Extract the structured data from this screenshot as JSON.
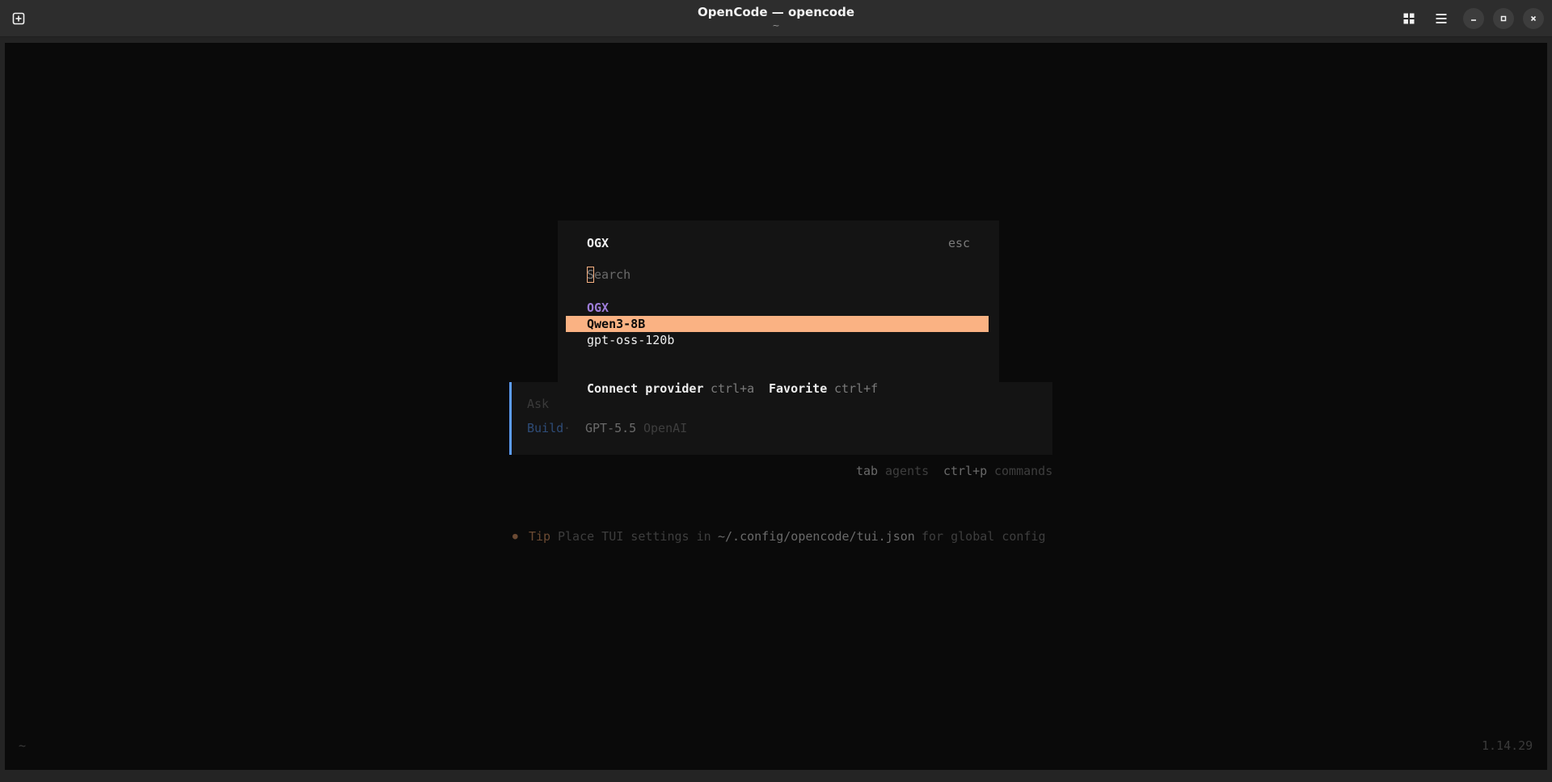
{
  "window": {
    "title": "OpenCode — opencode",
    "subtitle": "~"
  },
  "prompt": {
    "placeholder": "Ask",
    "agent": "Build",
    "separator": "·",
    "model": "GPT-5.5",
    "provider": "OpenAI"
  },
  "hints": {
    "tab_key": "tab",
    "tab_label": "agents",
    "cmd_key": "ctrl+p",
    "cmd_label": "commands"
  },
  "tip": {
    "bullet": "●",
    "label": "Tip",
    "text_before": "Place TUI settings in",
    "path": "~/.config/opencode/tui.json",
    "text_after": "for global config"
  },
  "footer": {
    "cwd": "~",
    "version": "1.14.29"
  },
  "dialog": {
    "title": "OGX",
    "close_hint": "esc",
    "search_placeholder": "Search",
    "cursor_char": "S",
    "group_label": "OGX",
    "items": [
      {
        "label": "Qwen3-8B",
        "selected": true
      },
      {
        "label": "gpt-oss-120b",
        "selected": false
      }
    ],
    "actions": [
      {
        "label": "Connect provider",
        "shortcut": "ctrl+a"
      },
      {
        "label": "Favorite",
        "shortcut": "ctrl+f"
      }
    ]
  },
  "colors": {
    "accent": "#fab283",
    "group": "#9d7cd8",
    "agent": "#5c9cf5"
  }
}
